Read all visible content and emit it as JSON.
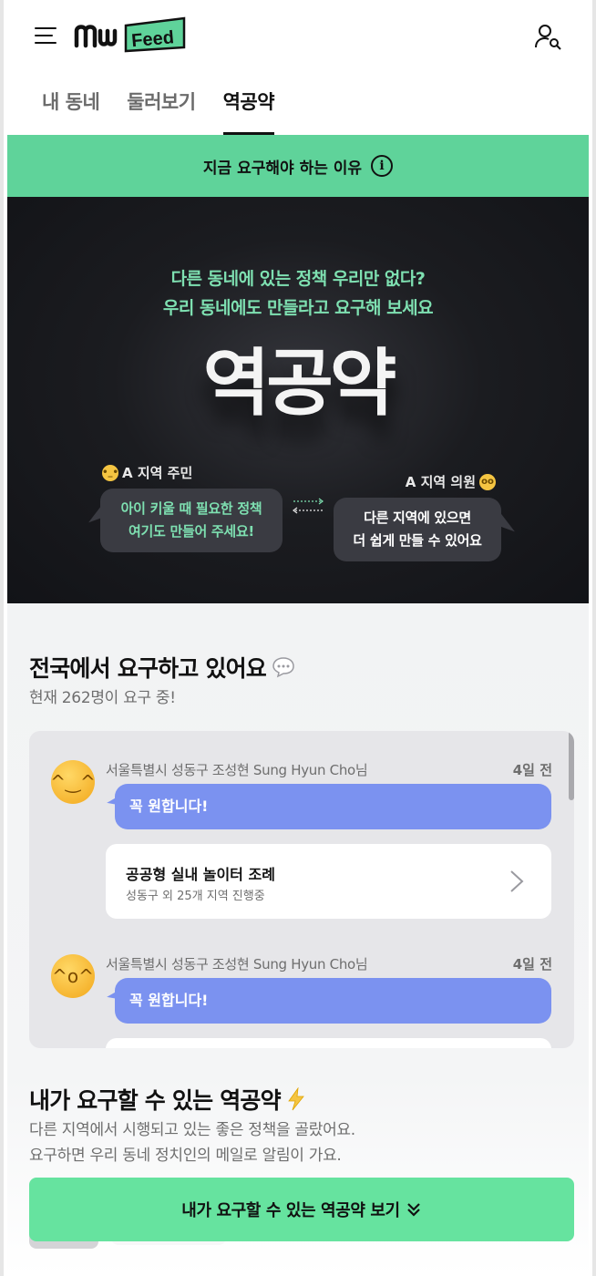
{
  "header": {
    "logo_text": "Feed",
    "tabs": [
      {
        "label": "내 동네"
      },
      {
        "label": "둘러보기"
      },
      {
        "label": "역공약"
      }
    ]
  },
  "reason_bar": {
    "label": "지금 요구해야 하는 이유",
    "icon": "info-icon"
  },
  "hero": {
    "subtitle_line1": "다른 동네에 있는 정책 우리만 없다?",
    "subtitle_line2": "우리 동네에도 만들라고 요구해 보세요",
    "title": "역공약",
    "resident_label": "A 지역 주민",
    "resident_bubble_line1": "아이 키울 때 필요한 정책",
    "resident_bubble_line2": "여기도 만들어 주세요!",
    "official_label": "A 지역 의원",
    "official_bubble_line1": "다른 지역에 있으면",
    "official_bubble_line2": "더 쉽게 만들 수 있어요"
  },
  "nationwide": {
    "title": "전국에서 요구하고 있어요",
    "subtitle": "현재 262명이 요구 중!",
    "posts": [
      {
        "author": "서울특별시 성동구 조성현 Sung Hyun Cho님",
        "time": "4일 전",
        "message": "꼭 원합니다!",
        "card_title": "공공형 실내 놀이터 조례",
        "card_sub": "성동구 외 25개 지역 진행중"
      },
      {
        "author": "서울특별시 성동구 조성현 Sung Hyun Cho님",
        "time": "4일 전",
        "message": "꼭 원합니다!"
      }
    ]
  },
  "my_pledges": {
    "title": "내가 요구할 수 있는 역공약",
    "desc_line1": "다른 지역에서 시행되고 있는 좋은 정책을 골랐어요.",
    "desc_line2": "요구하면 우리 동네 정치인의 메일로 알림이 가요.",
    "cta_label": "내가 요구할 수 있는 역공약 보기"
  },
  "colors": {
    "brand_green": "#5fd39a",
    "cta_green": "#66e39f",
    "message_blue": "#7b92f0",
    "hero_accent": "#7ee0b1"
  }
}
